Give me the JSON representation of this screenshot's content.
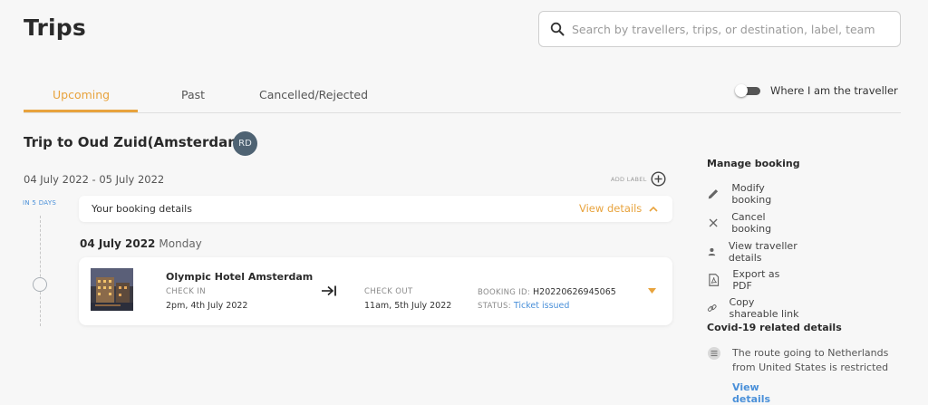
{
  "page": {
    "title": "Trips"
  },
  "search": {
    "placeholder": "Search by travellers, trips, or destination, label, team"
  },
  "tabs": [
    {
      "label": "Upcoming",
      "active": true
    },
    {
      "label": "Past",
      "active": false
    },
    {
      "label": "Cancelled/Rejected",
      "active": false
    }
  ],
  "toggle": {
    "label": "Where I am the traveller",
    "on": false
  },
  "trip": {
    "title": "Trip to Oud Zuid(Amsterdam)",
    "avatar_initials": "RD",
    "date_range": "04 July 2022 - 05 July 2022",
    "add_label": "ADD LABEL",
    "days_badge": "IN 5 DAYS",
    "details_label": "Your booking details",
    "view_details": "View details",
    "day_date": "04 July 2022",
    "day_weekday": "Monday"
  },
  "booking": {
    "hotel_name": "Olympic Hotel Amsterdam",
    "check_in_label": "CHECK IN",
    "check_in_value": "2pm, 4th July 2022",
    "check_out_label": "CHECK OUT",
    "check_out_value": "11am, 5th July 2022",
    "booking_id_label": "BOOKING ID:",
    "booking_id_value": "H20220626945065",
    "status_label": "STATUS:",
    "status_value": "Ticket issued"
  },
  "manage": {
    "heading": "Manage booking",
    "items": [
      {
        "label": "Modify booking",
        "icon": "pencil-icon"
      },
      {
        "label": "Cancel booking",
        "icon": "close-icon"
      },
      {
        "label": "View traveller details",
        "icon": "person-icon"
      },
      {
        "label": "Export as PDF",
        "icon": "pdf-icon"
      },
      {
        "label": "Copy shareable link",
        "icon": "link-icon"
      }
    ]
  },
  "covid": {
    "heading": "Covid-19 related details",
    "text": "The route going to Netherlands from United States is restricted",
    "link": "View details"
  },
  "colors": {
    "accent": "#e8a33d",
    "link": "#4a90d9",
    "avatar": "#4f6373"
  }
}
